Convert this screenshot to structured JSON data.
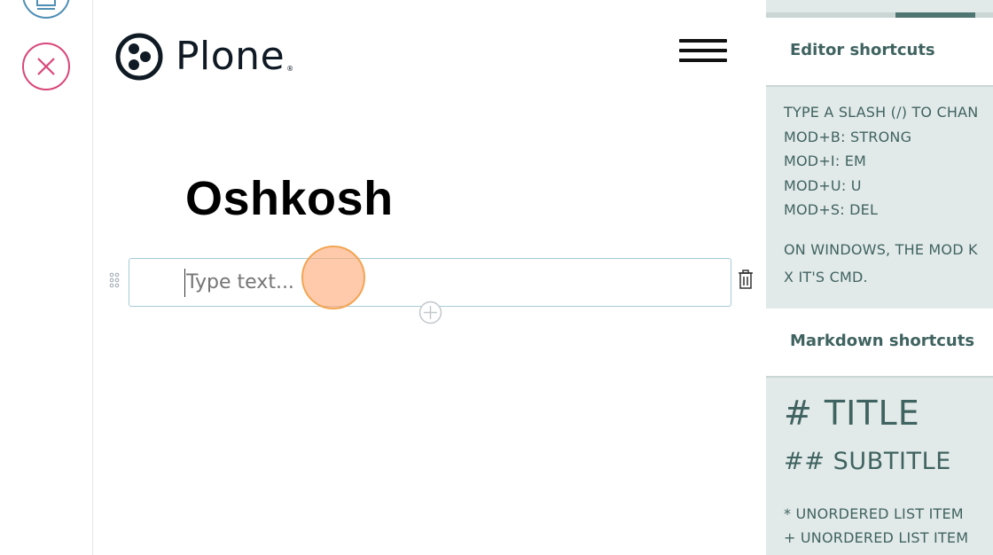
{
  "colors": {
    "accent": "#4e7572",
    "cancel": "#d9467a",
    "save": "#4f8fb5",
    "block_border": "#a6cbd6",
    "sidebar_bg": "#e2eae9",
    "sidebar_text": "#3f6360"
  },
  "toolbar": {
    "save_icon": "save-icon",
    "cancel_icon": "close-icon"
  },
  "header": {
    "logo_text": "Plone",
    "logo_reg": "®",
    "menu_icon": "hamburger-menu-icon"
  },
  "document": {
    "title": "Oshkosh",
    "block_placeholder": "Type text..."
  },
  "sidebar": {
    "editor_title": "Editor shortcuts",
    "editor_lines": [
      "TYPE A SLASH (/) TO CHAN",
      "MOD+B: STRONG",
      "MOD+I: EM",
      "MOD+U: U",
      "MOD+S: DEL"
    ],
    "editor_note": [
      "ON WINDOWS, THE MOD K",
      "X IT'S CMD."
    ],
    "markdown_title": "Markdown shortcuts",
    "markdown_title_example": "# TITLE",
    "markdown_subtitle_example": "## SUBTITLE",
    "markdown_list": [
      "* UNORDERED LIST ITEM",
      "+ UNORDERED LIST ITEM"
    ]
  }
}
